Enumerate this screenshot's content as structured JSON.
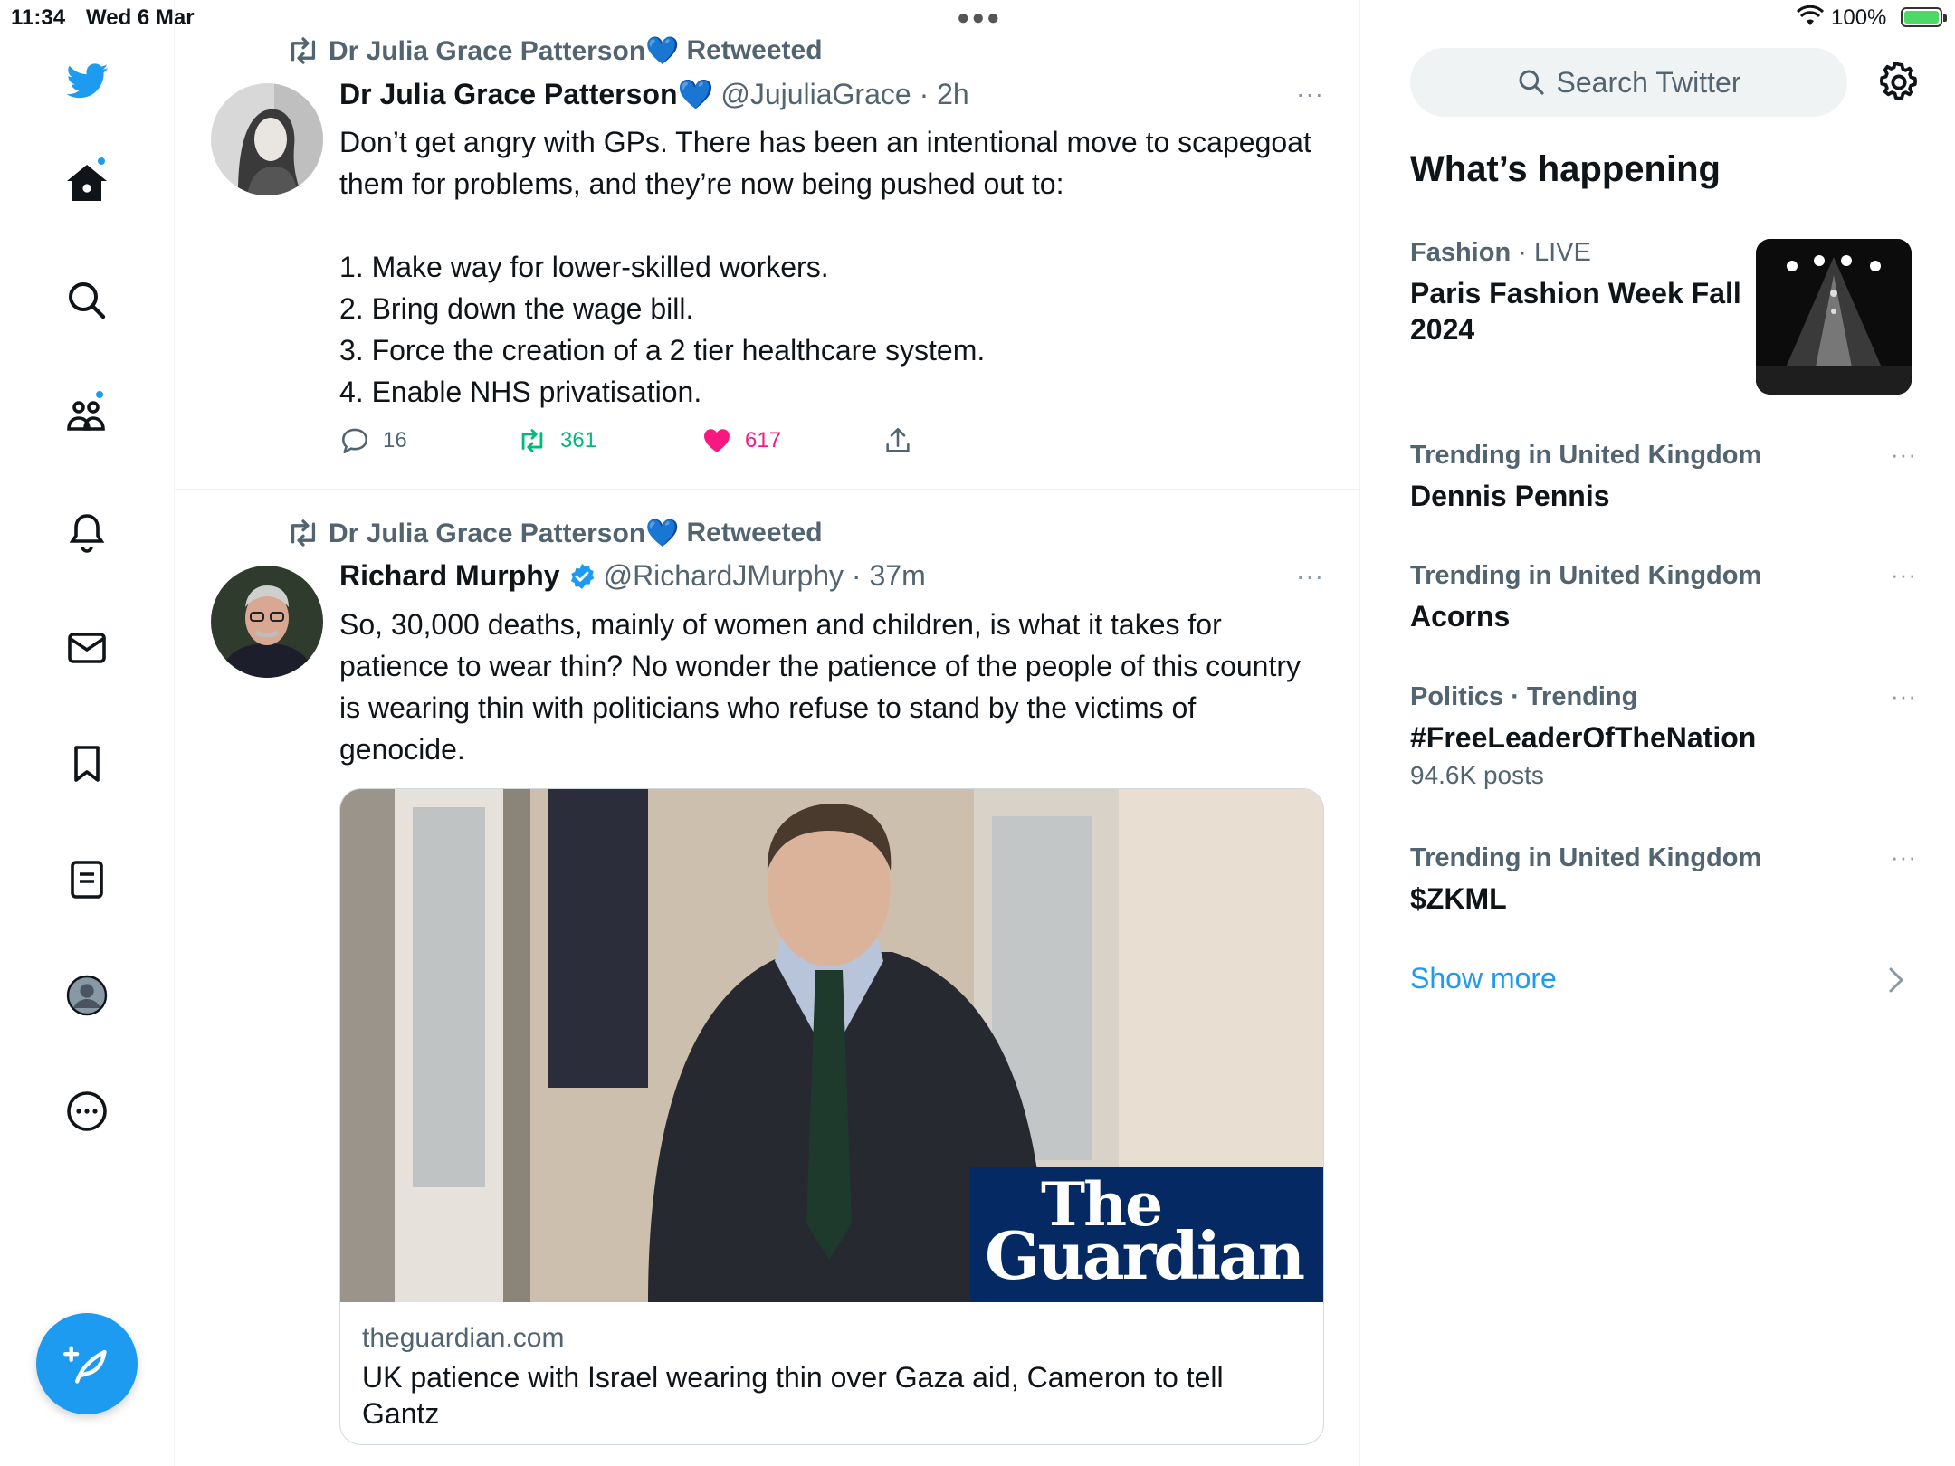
{
  "status_bar": {
    "time": "11:34",
    "date": "Wed 6 Mar",
    "battery": "100%",
    "battery_level": 1.0
  },
  "nav": {
    "icons": [
      "twitter-logo-icon",
      "home-icon",
      "search-icon",
      "communities-icon",
      "notifications-icon",
      "messages-icon",
      "bookmarks-icon",
      "lists-icon",
      "profile-icon",
      "more-icon",
      "compose-icon"
    ],
    "accent": "#1d9bf0"
  },
  "tweets": [
    {
      "retweeted_by": "Dr Julia Grace Patterson💙",
      "retweeted_label": "Retweeted",
      "author_name": "Dr Julia Grace Patterson💙",
      "handle_time": "@JujuliaGrace · 2h",
      "more": "···",
      "text": "Don’t get angry with GPs. There has been an intentional move to scapegoat them for problems, and they’re now being pushed out to:\n\n1. Make way for lower-skilled workers.\n2. Bring down the wage bill.\n3. Force the creation of a 2 tier healthcare system.\n4. Enable NHS privatisation.",
      "replies": "16",
      "retweets": "361",
      "likes": "617"
    },
    {
      "retweeted_by": "Dr Julia Grace Patterson💙",
      "retweeted_label": "Retweeted",
      "author_name": "Richard Murphy",
      "handle_time": "@RichardJMurphy · 37m",
      "more": "···",
      "text": "So, 30,000 deaths, mainly of women and children, is what it takes for patience to wear thin? No wonder the patience of the people of this country is wearing thin with politicians who refuse to stand by the victims of genocide.",
      "card": {
        "logo_line1": "The",
        "logo_line2": "Guardian",
        "domain": "theguardian.com",
        "title": "UK patience with Israel wearing thin over Gaza aid, Cameron to tell Gantz"
      }
    }
  ],
  "sidebar": {
    "search_placeholder": "Search Twitter",
    "section_title": "What’s happening",
    "trends": [
      {
        "category": "Fashion",
        "suffix": " · LIVE",
        "name": "Paris Fashion Week Fall 2024"
      },
      {
        "category": "Trending in United Kingdom",
        "suffix": "",
        "name": "Dennis Pennis"
      },
      {
        "category": "Trending in United Kingdom",
        "suffix": "",
        "name": "Acorns"
      },
      {
        "category": "Politics · Trending",
        "suffix": "",
        "name": "#FreeLeaderOfTheNation",
        "posts": "94.6K posts"
      },
      {
        "category": "Trending in United Kingdom",
        "suffix": "",
        "name": "$ZKML"
      }
    ],
    "trend_more": "···",
    "show_more": "Show more"
  }
}
